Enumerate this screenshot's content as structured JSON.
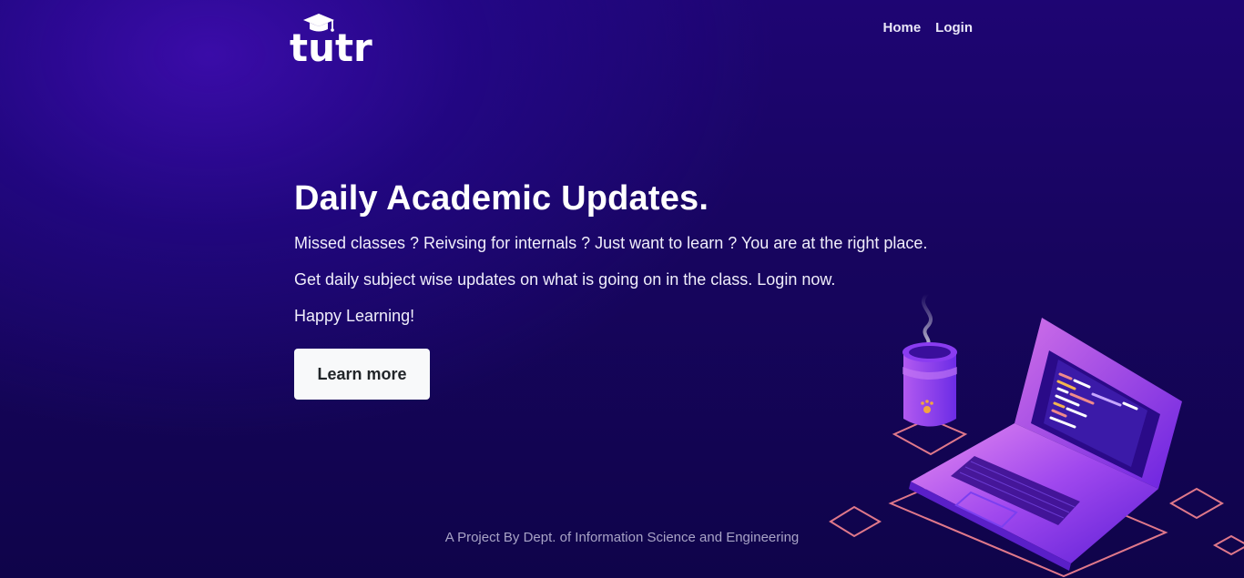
{
  "brand": {
    "name": "tutr",
    "icon": "graduation-cap-icon"
  },
  "nav": {
    "items": [
      {
        "label": "Home"
      },
      {
        "label": "Login"
      }
    ]
  },
  "hero": {
    "title": "Daily Academic Updates.",
    "paragraphs": [
      "Missed classes ? Reivsing for internals ? Just want to learn ? You are at the right place.",
      "Get daily subject wise updates on what is going on in the class. Login now.",
      "Happy Learning!"
    ],
    "cta_label": "Learn more"
  },
  "footer": {
    "text": "A Project By Dept. of Information Science and Engineering"
  },
  "colors": {
    "background": "#17055e",
    "accent": "#7b3ff2",
    "button_bg": "#f8f9fa",
    "button_text": "#212529",
    "outline_pink": "#e0788a"
  },
  "illustration": {
    "icon": "laptop-and-coffee-illustration"
  }
}
